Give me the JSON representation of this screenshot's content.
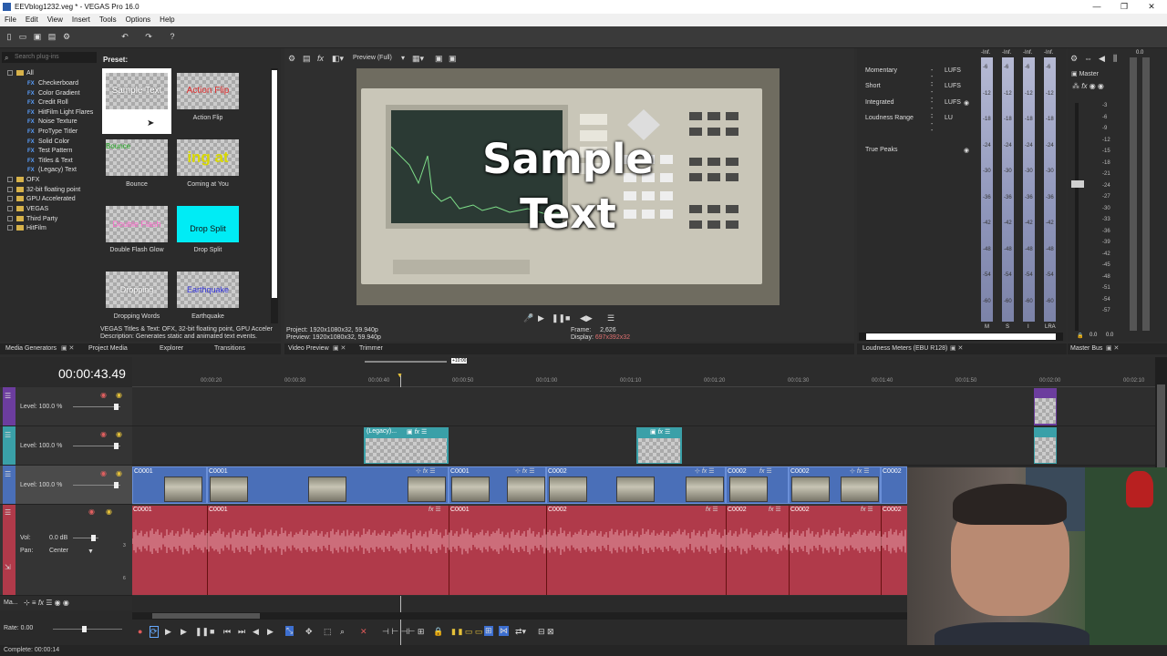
{
  "window": {
    "title": "EEVblog1232.veg * - VEGAS Pro 16.0",
    "controls": [
      "—",
      "❐",
      "✕"
    ]
  },
  "menu": [
    "File",
    "Edit",
    "View",
    "Insert",
    "Tools",
    "Options",
    "Help"
  ],
  "plugins": {
    "search_placeholder": "Search plug-ins",
    "tree": [
      {
        "label": "All",
        "type": "folder"
      },
      {
        "label": "Checkerboard",
        "type": "fx"
      },
      {
        "label": "Color Gradient",
        "type": "fx"
      },
      {
        "label": "Credit Roll",
        "type": "fx"
      },
      {
        "label": "HitFilm Light Flares",
        "type": "fx"
      },
      {
        "label": "Noise Texture",
        "type": "fx"
      },
      {
        "label": "ProType Titler",
        "type": "fx"
      },
      {
        "label": "Solid Color",
        "type": "fx"
      },
      {
        "label": "Test Pattern",
        "type": "fx"
      },
      {
        "label": "Titles & Text",
        "type": "fx",
        "selected": true
      },
      {
        "label": "(Legacy) Text",
        "type": "fx"
      },
      {
        "label": "OFX",
        "type": "folder"
      },
      {
        "label": "32-bit floating point",
        "type": "folder"
      },
      {
        "label": "GPU Accelerated",
        "type": "folder"
      },
      {
        "label": "VEGAS",
        "type": "folder"
      },
      {
        "label": "Third Party",
        "type": "folder"
      },
      {
        "label": "HitFilm",
        "type": "folder"
      }
    ],
    "preset_header": "Preset:",
    "presets": [
      {
        "name": "",
        "thumb_text": "Sample Text",
        "thumb_color": "#ffffff"
      },
      {
        "name": "Action Flip",
        "thumb_text": "Action Flip",
        "thumb_color": "#e03030"
      },
      {
        "name": "Bounce",
        "thumb_text": "Bounce",
        "thumb_color": "#22aa22"
      },
      {
        "name": "Coming at You",
        "thumb_text": "ing at",
        "thumb_color": "#d8d800"
      },
      {
        "name": "Double Flash Glow",
        "thumb_text": "Double Flash",
        "thumb_color": "#ff66cc"
      },
      {
        "name": "Drop Split",
        "thumb_text": "Drop Split",
        "thumb_color": "#111111"
      },
      {
        "name": "Dropping Words",
        "thumb_text": "Dropping",
        "thumb_color": "#ffffff"
      },
      {
        "name": "Earthquake",
        "thumb_text": "Earthquake",
        "thumb_color": "#3333dd"
      }
    ],
    "description_line1": "VEGAS Titles & Text: OFX, 32-bit floating point, GPU Acceler",
    "description_line2": "Description: Generates static and animated text events."
  },
  "left_tabs": [
    "Media Generators",
    "Project Media",
    "Explorer",
    "Transitions"
  ],
  "preview": {
    "mode": "Preview (Full)",
    "overlay_text_line1": "Sample",
    "overlay_text_line2": "Text",
    "project": "Project:  1920x1080x32, 59.940p",
    "preview_info": "Preview: 1920x1080x32, 59.940p",
    "frame_label": "Frame:",
    "frame_value": "2,626",
    "display_label": "Display:",
    "display_value": "697x392x32",
    "tabs": [
      "Video Preview",
      "Trimmer"
    ]
  },
  "loudness": {
    "rows": [
      {
        "label": "Momentary",
        "value": "---",
        "unit": "LUFS"
      },
      {
        "label": "Short",
        "value": "---",
        "unit": "LUFS"
      },
      {
        "label": "Integrated",
        "value": "---",
        "unit": "LUFS"
      },
      {
        "label": "Loudness Range",
        "value": "---",
        "unit": "LU"
      },
      {
        "label": "True Peaks",
        "value": "",
        "unit": ""
      }
    ],
    "meter_headers": [
      "-Inf.",
      "-Inf.",
      "-Inf.",
      "-Inf."
    ],
    "scale": [
      "-6",
      "-12",
      "-18",
      "-24",
      "-30",
      "-36",
      "-42",
      "-48",
      "-54",
      "-60"
    ],
    "meter_labels": [
      "M",
      "S",
      "I",
      "LRA"
    ],
    "tab": "Loudness Meters (EBU R128)"
  },
  "master": {
    "label": "Master",
    "peak": "0.0",
    "scale": [
      "3",
      "6",
      "9",
      "12",
      "15",
      "18",
      "21",
      "24",
      "27",
      "30",
      "33",
      "36",
      "39",
      "42",
      "45",
      "48",
      "51",
      "54",
      "57"
    ],
    "bottom_values": [
      "0.0",
      "0.0"
    ],
    "tab": "Master Bus"
  },
  "timeline": {
    "timecode": "00:00:43.49",
    "loop_marker": "+10:00",
    "ruler": [
      "00:00:20",
      "00:00:30",
      "00:00:40",
      "00:00:50",
      "00:01:00",
      "00:01:10",
      "00:01:20",
      "00:01:30",
      "00:01:40",
      "00:01:50",
      "00:02:00",
      "00:02:10"
    ],
    "tracks": [
      {
        "level": "Level: 100.0 %",
        "color": "#6c3d9e"
      },
      {
        "level": "Level: 100.0 %",
        "color": "#3aa0a8"
      },
      {
        "level": "Level: 100.0 %",
        "color": "#4a6fb8"
      }
    ],
    "audio": {
      "vol_label": "Vol:",
      "vol_value": "0.0 dB",
      "pan_label": "Pan:",
      "pan_value": "Center",
      "color": "#b03a4a"
    },
    "text_clip_label": "(Legacy)...",
    "video_clips": [
      "C0001",
      "C0001",
      "C0001",
      "C0002",
      "C0002",
      "C0002",
      "C0002"
    ],
    "audio_clips": [
      "C0001",
      "C0001",
      "C0001",
      "C0002",
      "C0002",
      "C0002",
      "C0002"
    ],
    "bottom_left": "Ma...",
    "rate": "Rate: 0.00"
  },
  "status": "Complete: 00:00:14"
}
